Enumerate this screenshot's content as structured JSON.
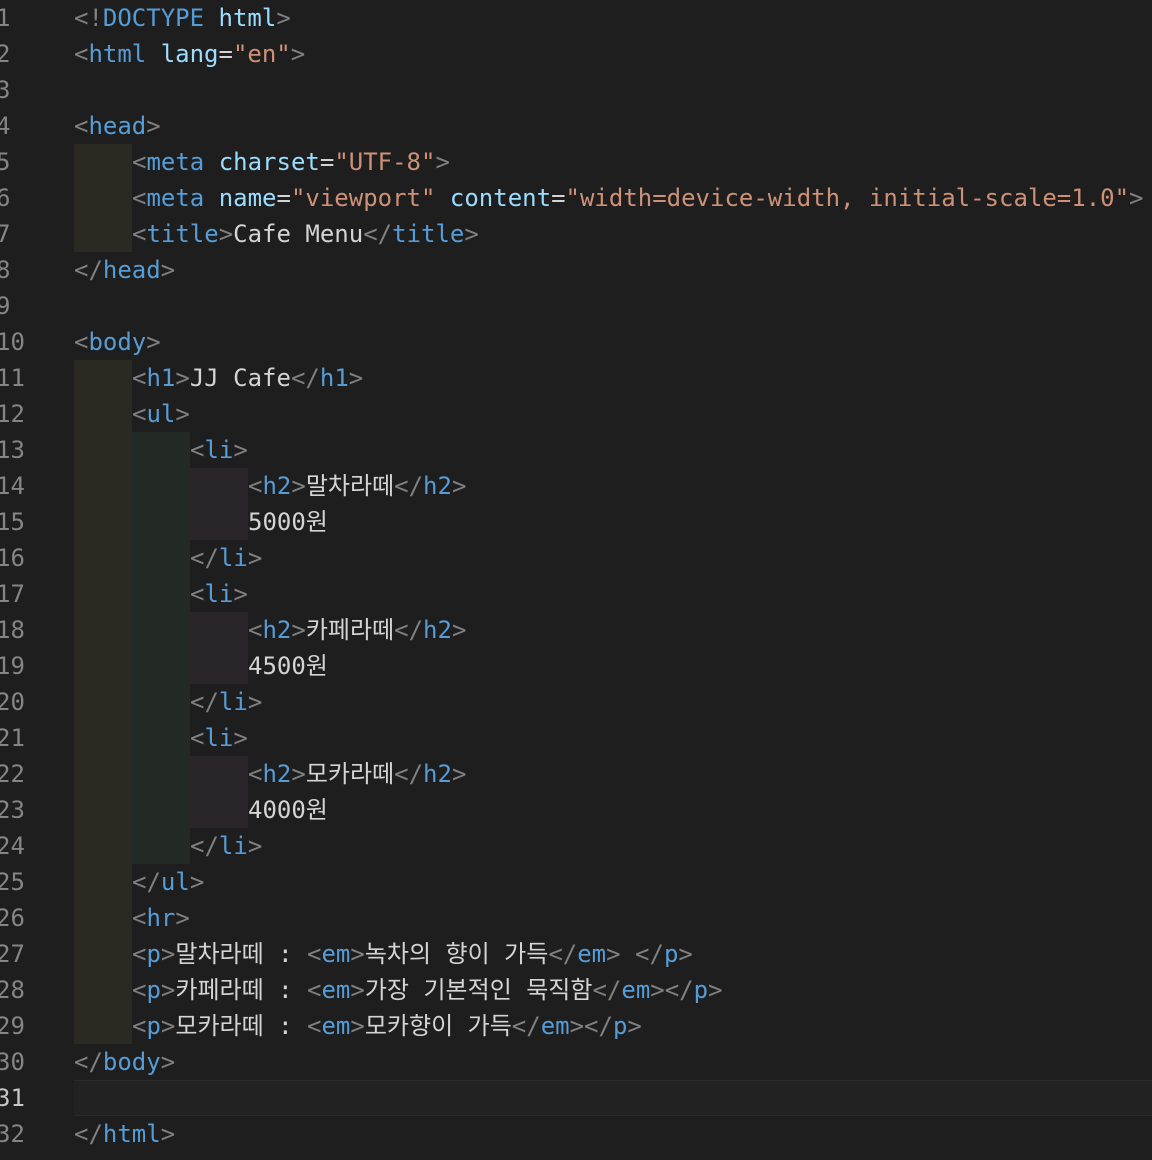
{
  "editor": {
    "line_numbers": [
      "1",
      "2",
      "3",
      "4",
      "5",
      "6",
      "7",
      "8",
      "9",
      "10",
      "11",
      "12",
      "13",
      "14",
      "15",
      "16",
      "17",
      "18",
      "19",
      "20",
      "21",
      "22",
      "23",
      "24",
      "25",
      "26",
      "27",
      "28",
      "29",
      "30",
      "31",
      "32"
    ],
    "active_line": "31",
    "lines": [
      [
        {
          "c": "p",
          "t": "<!"
        },
        {
          "c": "t",
          "t": "DOCTYPE"
        },
        {
          "c": "x",
          "t": " "
        },
        {
          "c": "a",
          "t": "html"
        },
        {
          "c": "p",
          "t": ">"
        }
      ],
      [
        {
          "c": "p",
          "t": "<"
        },
        {
          "c": "t",
          "t": "html"
        },
        {
          "c": "x",
          "t": " "
        },
        {
          "c": "a",
          "t": "lang"
        },
        {
          "c": "x",
          "t": "="
        },
        {
          "c": "s",
          "t": "\"en\""
        },
        {
          "c": "p",
          "t": ">"
        }
      ],
      [],
      [
        {
          "c": "p",
          "t": "<"
        },
        {
          "c": "t",
          "t": "head"
        },
        {
          "c": "p",
          "t": ">"
        }
      ],
      [
        {
          "c": "p",
          "t": "<"
        },
        {
          "c": "t",
          "t": "meta"
        },
        {
          "c": "x",
          "t": " "
        },
        {
          "c": "a",
          "t": "charset"
        },
        {
          "c": "x",
          "t": "="
        },
        {
          "c": "s",
          "t": "\"UTF-8\""
        },
        {
          "c": "p",
          "t": ">"
        }
      ],
      [
        {
          "c": "p",
          "t": "<"
        },
        {
          "c": "t",
          "t": "meta"
        },
        {
          "c": "x",
          "t": " "
        },
        {
          "c": "a",
          "t": "name"
        },
        {
          "c": "x",
          "t": "="
        },
        {
          "c": "s",
          "t": "\"viewport\""
        },
        {
          "c": "x",
          "t": " "
        },
        {
          "c": "a",
          "t": "content"
        },
        {
          "c": "x",
          "t": "="
        },
        {
          "c": "s",
          "t": "\"width=device-width, initial-scale=1.0\""
        },
        {
          "c": "p",
          "t": ">"
        }
      ],
      [
        {
          "c": "p",
          "t": "<"
        },
        {
          "c": "t",
          "t": "title"
        },
        {
          "c": "p",
          "t": ">"
        },
        {
          "c": "x",
          "t": "Cafe Menu"
        },
        {
          "c": "p",
          "t": "</"
        },
        {
          "c": "t",
          "t": "title"
        },
        {
          "c": "p",
          "t": ">"
        }
      ],
      [
        {
          "c": "p",
          "t": "</"
        },
        {
          "c": "t",
          "t": "head"
        },
        {
          "c": "p",
          "t": ">"
        }
      ],
      [],
      [
        {
          "c": "p",
          "t": "<"
        },
        {
          "c": "t",
          "t": "body"
        },
        {
          "c": "p",
          "t": ">"
        }
      ],
      [
        {
          "c": "p",
          "t": "<"
        },
        {
          "c": "t",
          "t": "h1"
        },
        {
          "c": "p",
          "t": ">"
        },
        {
          "c": "x",
          "t": "JJ Cafe"
        },
        {
          "c": "p",
          "t": "</"
        },
        {
          "c": "t",
          "t": "h1"
        },
        {
          "c": "p",
          "t": ">"
        }
      ],
      [
        {
          "c": "p",
          "t": "<"
        },
        {
          "c": "t",
          "t": "ul"
        },
        {
          "c": "p",
          "t": ">"
        }
      ],
      [
        {
          "c": "p",
          "t": "<"
        },
        {
          "c": "t",
          "t": "li"
        },
        {
          "c": "p",
          "t": ">"
        }
      ],
      [
        {
          "c": "p",
          "t": "<"
        },
        {
          "c": "t",
          "t": "h2"
        },
        {
          "c": "p",
          "t": ">"
        },
        {
          "c": "x",
          "t": "말차라떼"
        },
        {
          "c": "p",
          "t": "</"
        },
        {
          "c": "t",
          "t": "h2"
        },
        {
          "c": "p",
          "t": ">"
        }
      ],
      [
        {
          "c": "x",
          "t": "5000원"
        }
      ],
      [
        {
          "c": "p",
          "t": "</"
        },
        {
          "c": "t",
          "t": "li"
        },
        {
          "c": "p",
          "t": ">"
        }
      ],
      [
        {
          "c": "p",
          "t": "<"
        },
        {
          "c": "t",
          "t": "li"
        },
        {
          "c": "p",
          "t": ">"
        }
      ],
      [
        {
          "c": "p",
          "t": "<"
        },
        {
          "c": "t",
          "t": "h2"
        },
        {
          "c": "p",
          "t": ">"
        },
        {
          "c": "x",
          "t": "카페라떼"
        },
        {
          "c": "p",
          "t": "</"
        },
        {
          "c": "t",
          "t": "h2"
        },
        {
          "c": "p",
          "t": ">"
        }
      ],
      [
        {
          "c": "x",
          "t": "4500원"
        }
      ],
      [
        {
          "c": "p",
          "t": "</"
        },
        {
          "c": "t",
          "t": "li"
        },
        {
          "c": "p",
          "t": ">"
        }
      ],
      [
        {
          "c": "p",
          "t": "<"
        },
        {
          "c": "t",
          "t": "li"
        },
        {
          "c": "p",
          "t": ">"
        }
      ],
      [
        {
          "c": "p",
          "t": "<"
        },
        {
          "c": "t",
          "t": "h2"
        },
        {
          "c": "p",
          "t": ">"
        },
        {
          "c": "x",
          "t": "모카라떼"
        },
        {
          "c": "p",
          "t": "</"
        },
        {
          "c": "t",
          "t": "h2"
        },
        {
          "c": "p",
          "t": ">"
        }
      ],
      [
        {
          "c": "x",
          "t": "4000원"
        }
      ],
      [
        {
          "c": "p",
          "t": "</"
        },
        {
          "c": "t",
          "t": "li"
        },
        {
          "c": "p",
          "t": ">"
        }
      ],
      [
        {
          "c": "p",
          "t": "</"
        },
        {
          "c": "t",
          "t": "ul"
        },
        {
          "c": "p",
          "t": ">"
        }
      ],
      [
        {
          "c": "p",
          "t": "<"
        },
        {
          "c": "t",
          "t": "hr"
        },
        {
          "c": "p",
          "t": ">"
        }
      ],
      [
        {
          "c": "p",
          "t": "<"
        },
        {
          "c": "t",
          "t": "p"
        },
        {
          "c": "p",
          "t": ">"
        },
        {
          "c": "x",
          "t": "말차라떼 : "
        },
        {
          "c": "p",
          "t": "<"
        },
        {
          "c": "t",
          "t": "em"
        },
        {
          "c": "p",
          "t": ">"
        },
        {
          "c": "x",
          "t": "녹차의 향이 가득"
        },
        {
          "c": "p",
          "t": "</"
        },
        {
          "c": "t",
          "t": "em"
        },
        {
          "c": "p",
          "t": ">"
        },
        {
          "c": "x",
          "t": " "
        },
        {
          "c": "p",
          "t": "</"
        },
        {
          "c": "t",
          "t": "p"
        },
        {
          "c": "p",
          "t": ">"
        }
      ],
      [
        {
          "c": "p",
          "t": "<"
        },
        {
          "c": "t",
          "t": "p"
        },
        {
          "c": "p",
          "t": ">"
        },
        {
          "c": "x",
          "t": "카페라떼 : "
        },
        {
          "c": "p",
          "t": "<"
        },
        {
          "c": "t",
          "t": "em"
        },
        {
          "c": "p",
          "t": ">"
        },
        {
          "c": "x",
          "t": "가장 기본적인 묵직함"
        },
        {
          "c": "p",
          "t": "</"
        },
        {
          "c": "t",
          "t": "em"
        },
        {
          "c": "p",
          "t": "></"
        },
        {
          "c": "t",
          "t": "p"
        },
        {
          "c": "p",
          "t": ">"
        }
      ],
      [
        {
          "c": "p",
          "t": "<"
        },
        {
          "c": "t",
          "t": "p"
        },
        {
          "c": "p",
          "t": ">"
        },
        {
          "c": "x",
          "t": "모카라떼 : "
        },
        {
          "c": "p",
          "t": "<"
        },
        {
          "c": "t",
          "t": "em"
        },
        {
          "c": "p",
          "t": ">"
        },
        {
          "c": "x",
          "t": "모카향이 가득"
        },
        {
          "c": "p",
          "t": "</"
        },
        {
          "c": "t",
          "t": "em"
        },
        {
          "c": "p",
          "t": "></"
        },
        {
          "c": "t",
          "t": "p"
        },
        {
          "c": "p",
          "t": ">"
        }
      ],
      [
        {
          "c": "p",
          "t": "</"
        },
        {
          "c": "t",
          "t": "body"
        },
        {
          "c": "p",
          "t": ">"
        }
      ],
      [],
      [
        {
          "c": "p",
          "t": "</"
        },
        {
          "c": "t",
          "t": "html"
        },
        {
          "c": "p",
          "t": ">"
        }
      ]
    ]
  }
}
